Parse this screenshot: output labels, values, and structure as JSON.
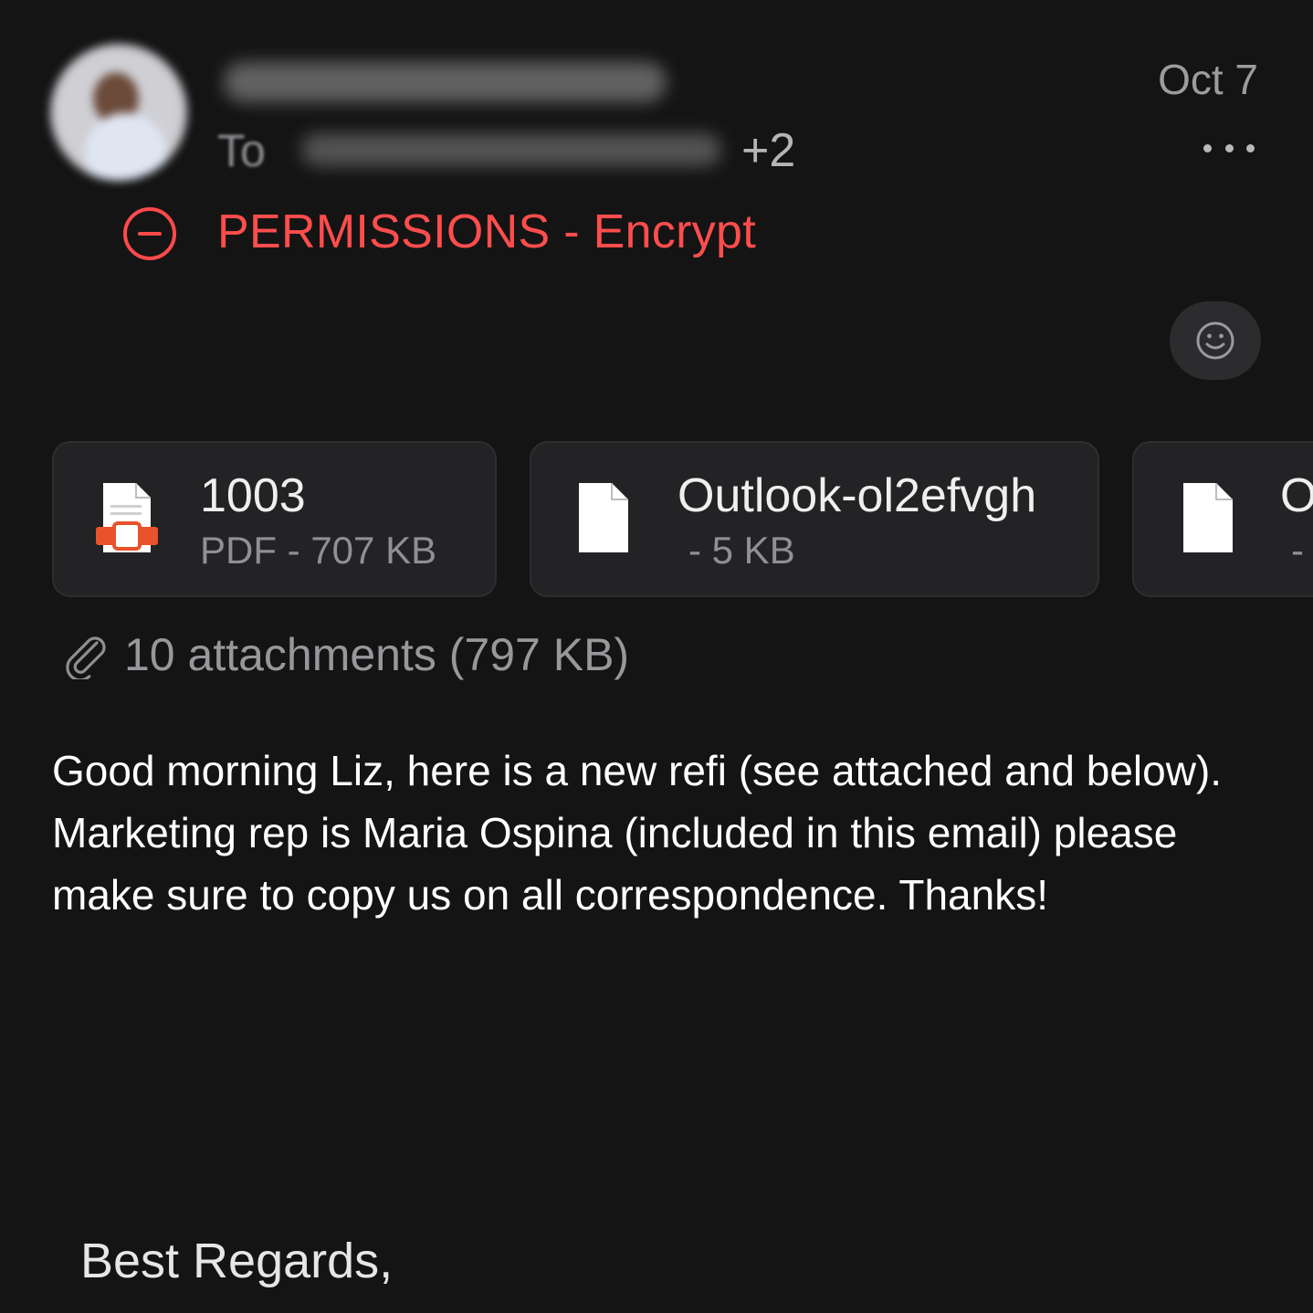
{
  "header": {
    "date": "Oct 7",
    "to_label": "To",
    "recipient_extra": "+2",
    "more_icon": "ellipsis-icon"
  },
  "permission": {
    "label": "PERMISSIONS - Encrypt",
    "icon": "minus-circle-icon",
    "color": "#ff4d4d"
  },
  "reaction": {
    "icon": "smiley-icon"
  },
  "attachments": {
    "cards": [
      {
        "name": "1003",
        "meta": "PDF - 707 KB",
        "icon": "pdf-file-icon"
      },
      {
        "name": "Outlook-ol2efvgh",
        "meta": "- 5 KB",
        "icon": "file-icon"
      },
      {
        "name": "O",
        "meta": "-",
        "icon": "file-icon"
      }
    ],
    "summary": "10 attachments (797 KB)",
    "summary_icon": "paperclip-icon"
  },
  "body": {
    "text": "Good morning Liz, here is a new refi (see attached and below). Marketing rep is Maria Ospina (included in this email) please make sure to copy us on all correspondence. Thanks!",
    "signoff": "Best Regards,"
  }
}
